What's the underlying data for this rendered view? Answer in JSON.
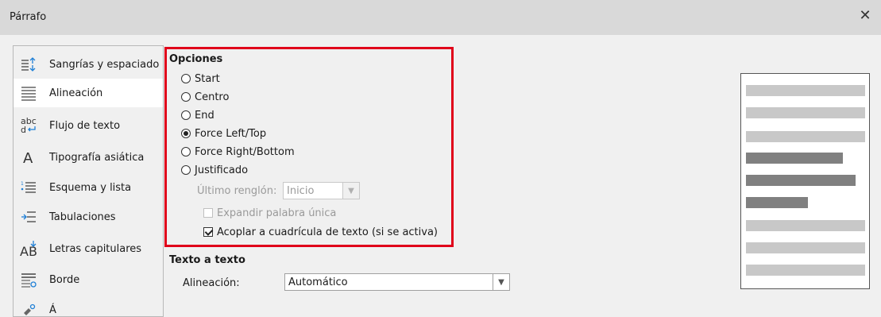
{
  "window": {
    "title": "Párrafo",
    "close_icon": "close-icon"
  },
  "sidebar": {
    "items": [
      {
        "label": "Sangrías y espaciado",
        "icon": "indent-spacing-icon"
      },
      {
        "label": "Alineación",
        "icon": "align-justify-icon",
        "selected": true
      },
      {
        "label": "Flujo de texto",
        "icon": "text-flow-icon"
      },
      {
        "label": "Tipografía asiática",
        "icon": "asian-typography-icon"
      },
      {
        "label": "Esquema y lista",
        "icon": "outline-list-icon"
      },
      {
        "label": "Tabulaciones",
        "icon": "tabs-icon"
      },
      {
        "label": "Letras capitulares",
        "icon": "drop-caps-icon"
      },
      {
        "label": "Borde",
        "icon": "border-icon"
      },
      {
        "label": "Á",
        "icon": "area-icon"
      }
    ]
  },
  "options": {
    "title": "Opciones",
    "radios": [
      {
        "label": "Start",
        "checked": false
      },
      {
        "label": "Centro",
        "checked": false
      },
      {
        "label": "End",
        "checked": false
      },
      {
        "label": "Force Left/Top",
        "checked": true
      },
      {
        "label": "Force Right/Bottom",
        "checked": false
      },
      {
        "label": "Justificado",
        "checked": false
      }
    ],
    "last_line_label": "Último renglón:",
    "last_line_value": "Inicio",
    "expand_word_label": "Expandir palabra única",
    "expand_word_checked": false,
    "snap_grid_label": "Acoplar a cuadrícula de texto (si se activa)",
    "snap_grid_checked": true
  },
  "text_to_text": {
    "title": "Texto a texto",
    "alignment_label": "Alineación:",
    "alignment_value": "Automático"
  },
  "colors": {
    "highlight_border": "#e0001a"
  }
}
